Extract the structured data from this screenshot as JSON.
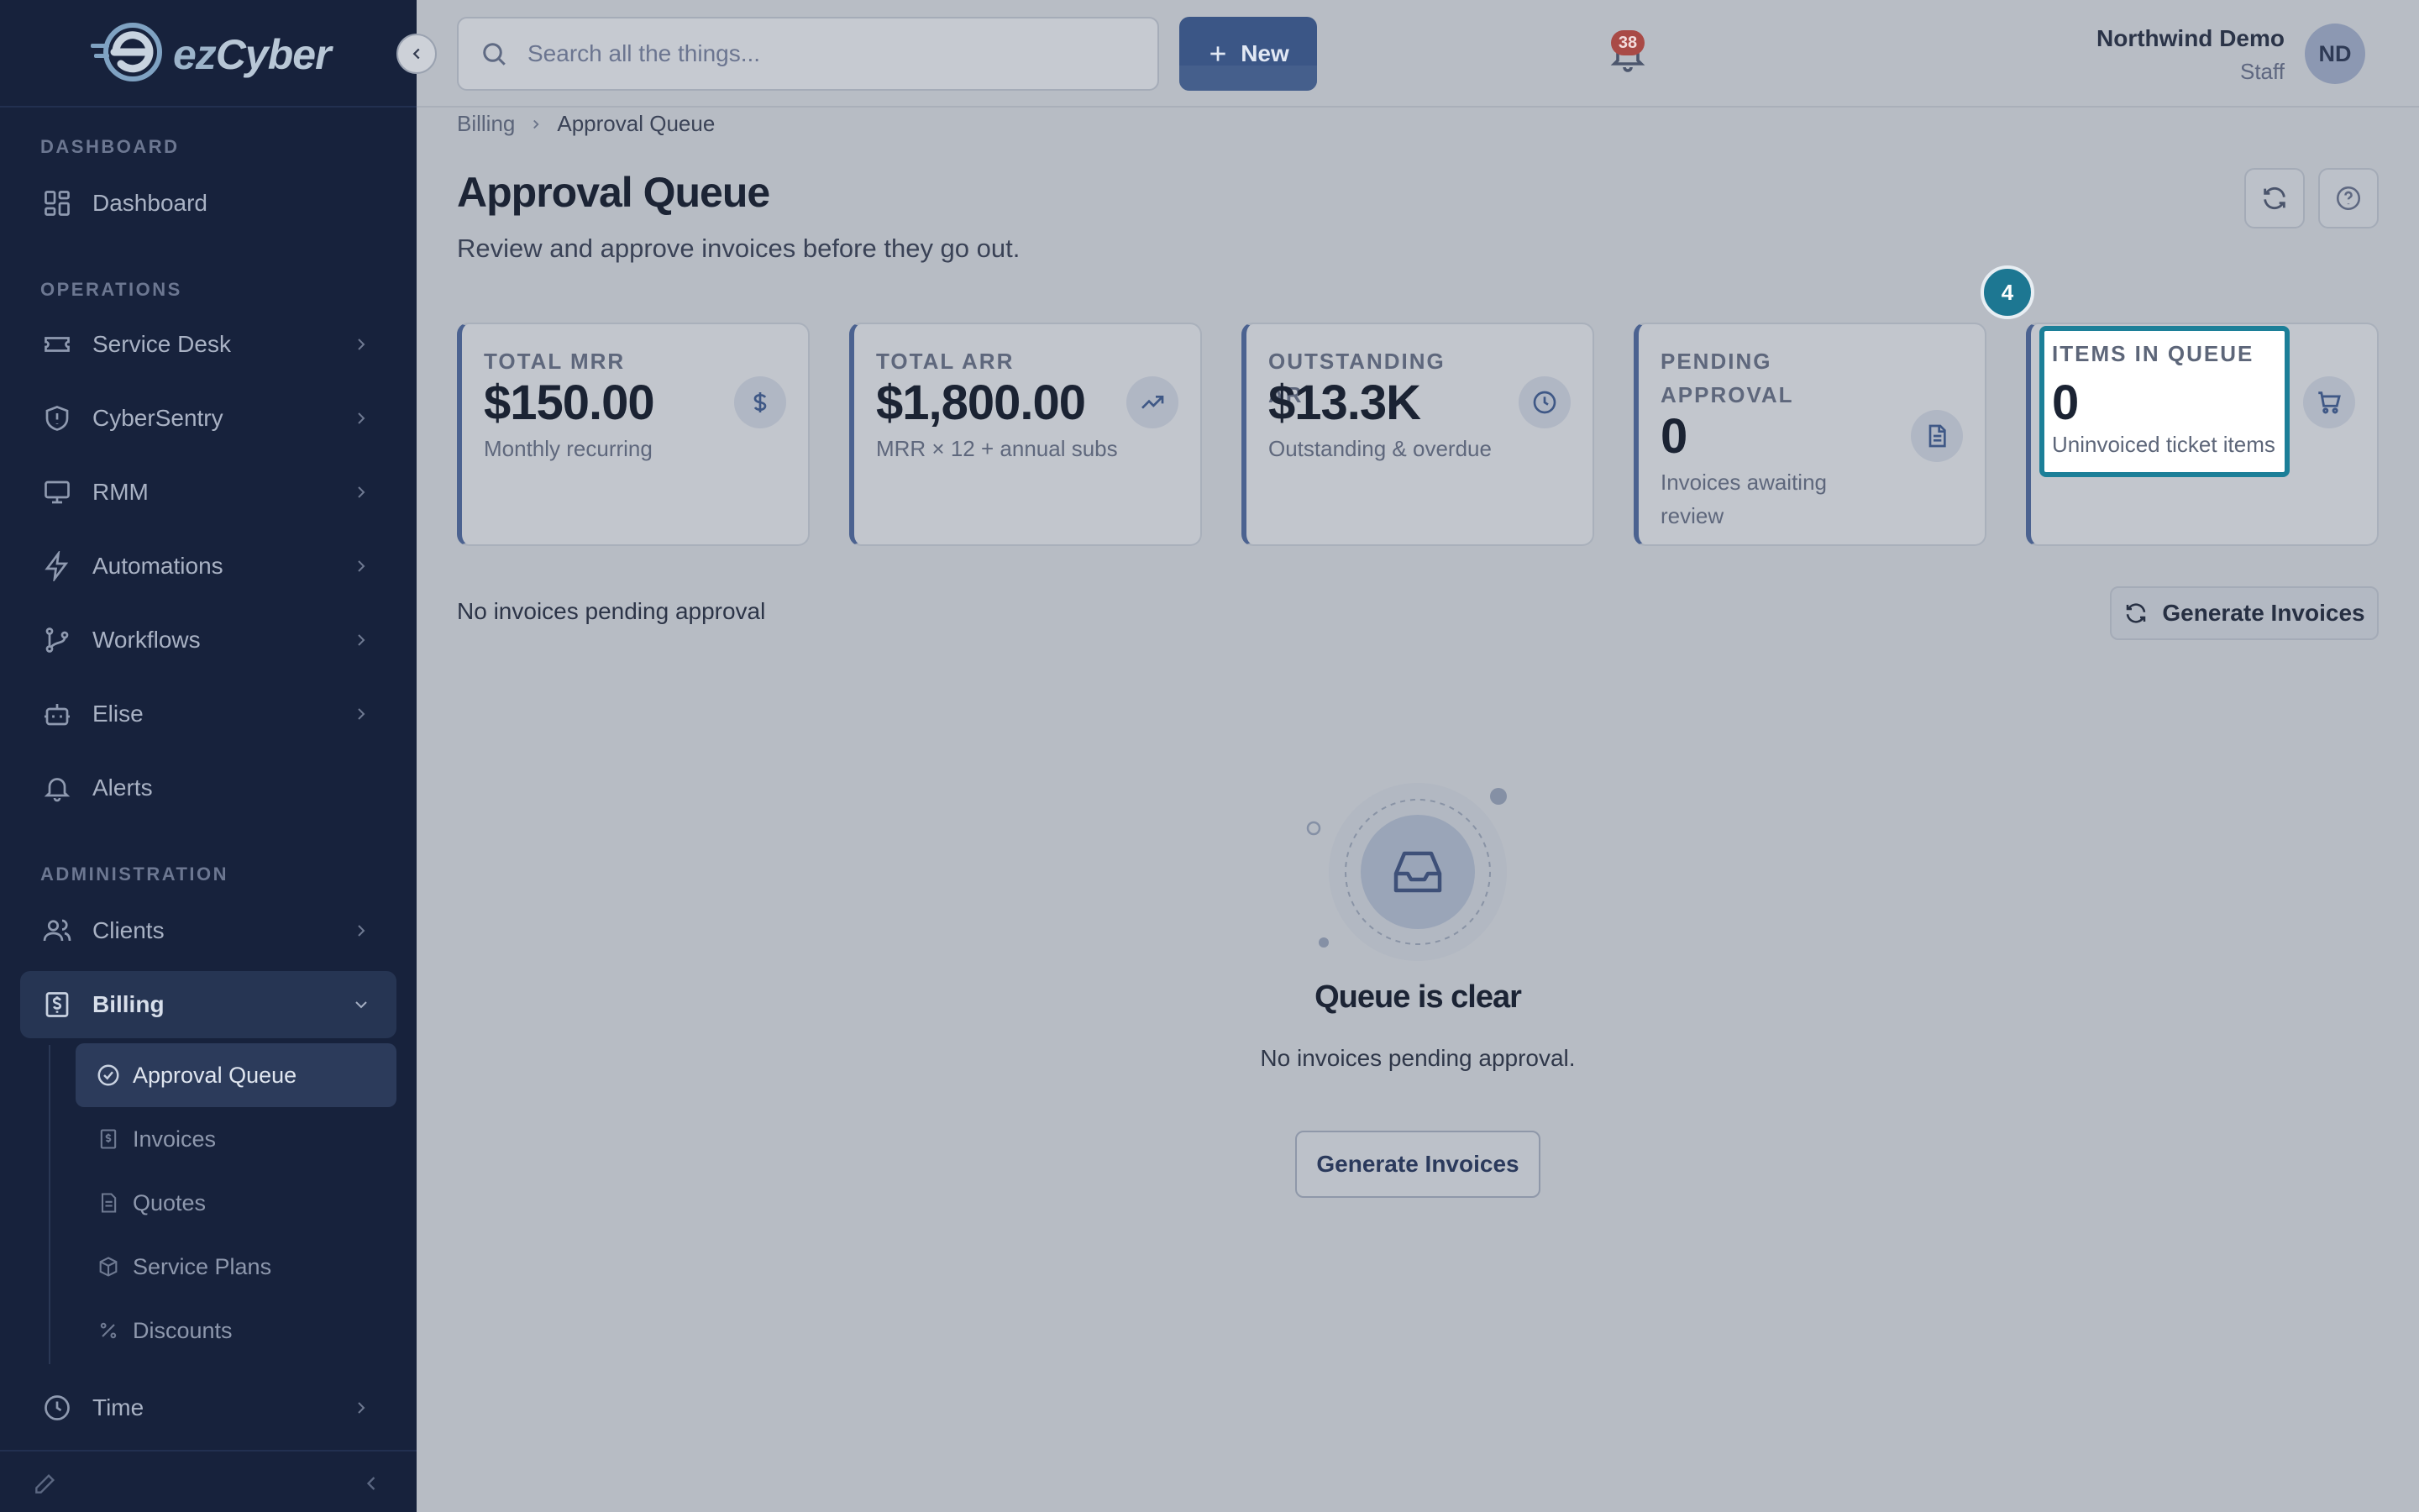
{
  "app": {
    "logo_prefix": "ez",
    "logo_suffix": "Cyber"
  },
  "sidebar": {
    "sections": [
      {
        "title": "DASHBOARD"
      },
      {
        "title": "OPERATIONS"
      },
      {
        "title": "ADMINISTRATION"
      }
    ],
    "items": [
      {
        "label": "Dashboard",
        "icon": "grid-icon"
      },
      {
        "label": "Service Desk",
        "icon": "ticket-icon"
      },
      {
        "label": "CyberSentry",
        "icon": "shield-icon"
      },
      {
        "label": "RMM",
        "icon": "monitor-icon"
      },
      {
        "label": "Automations",
        "icon": "bolt-icon"
      },
      {
        "label": "Workflows",
        "icon": "git-branch-icon"
      },
      {
        "label": "Elise",
        "icon": "bot-icon"
      },
      {
        "label": "Alerts",
        "icon": "bell-icon"
      },
      {
        "label": "Clients",
        "icon": "users-icon"
      },
      {
        "label": "Billing",
        "icon": "receipt-icon"
      },
      {
        "label": "Time",
        "icon": "clock-icon"
      }
    ],
    "billing_sub": [
      {
        "label": "Approval Queue",
        "icon": "check-circle-icon"
      },
      {
        "label": "Invoices",
        "icon": "invoice-icon"
      },
      {
        "label": "Quotes",
        "icon": "document-icon"
      },
      {
        "label": "Service Plans",
        "icon": "package-icon"
      },
      {
        "label": "Discounts",
        "icon": "percent-icon"
      }
    ]
  },
  "topbar": {
    "search_placeholder": "Search all the things...",
    "new_label": "New",
    "notification_count": "38",
    "user_name": "Northwind Demo",
    "user_role": "Staff",
    "avatar_initials": "ND"
  },
  "breadcrumb": {
    "parent": "Billing",
    "current": "Approval Queue"
  },
  "page": {
    "title": "Approval Queue",
    "subtitle": "Review and approve invoices before they go out."
  },
  "stats": [
    {
      "label": "TOTAL MRR",
      "value": "$150.00",
      "note": "Monthly recurring",
      "icon": "dollar-icon"
    },
    {
      "label": "TOTAL ARR",
      "value": "$1,800.00",
      "note": "MRR × 12 + annual subs",
      "icon": "trending-up-icon"
    },
    {
      "label": "OUTSTANDING AR",
      "value": "$13.3K",
      "note": "Outstanding & overdue",
      "icon": "clock-icon"
    },
    {
      "label": "PENDING APPROVAL",
      "value": "0",
      "note": "Invoices awaiting review",
      "icon": "file-text-icon"
    },
    {
      "label": "ITEMS IN QUEUE",
      "value": "0",
      "note": "Uninvoiced ticket items",
      "icon": "cart-icon"
    }
  ],
  "tour": {
    "step_number": "4"
  },
  "queue": {
    "status_text": "No invoices pending approval",
    "generate_label": "Generate Invoices",
    "empty_title": "Queue is clear",
    "empty_subtitle": "No invoices pending approval.",
    "empty_button": "Generate Invoices"
  },
  "colors": {
    "sidebar_bg": "#17223c",
    "accent": "#3b5686",
    "highlight": "#1c7f98",
    "badge": "#a94a46"
  }
}
